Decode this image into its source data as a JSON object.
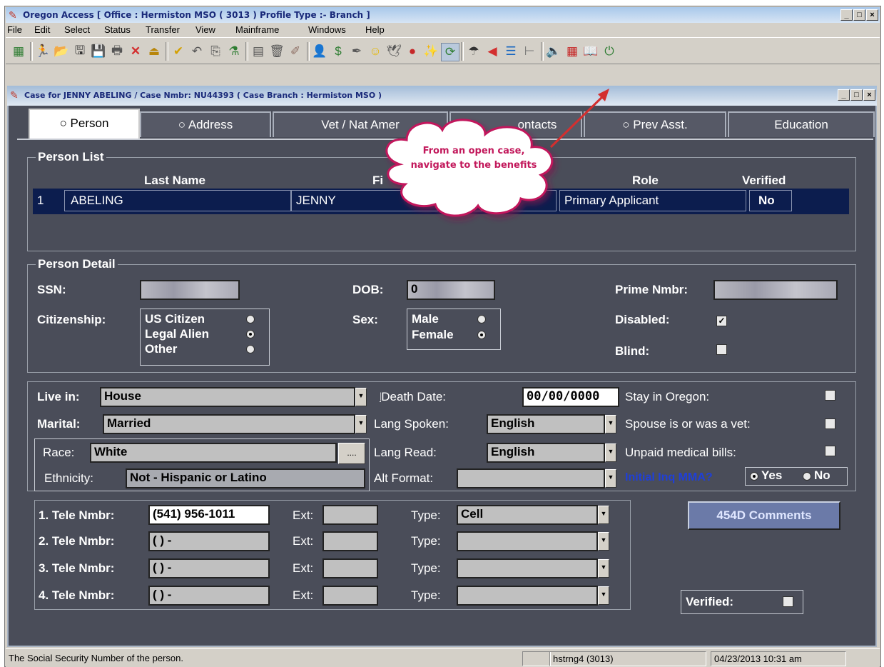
{
  "app": {
    "title": "Oregon Access [ Office : Hermiston MSO ( 3013 ) Profile Type :- Branch ]",
    "menu": [
      "File",
      "Edit",
      "Select",
      "Status",
      "Transfer",
      "View",
      "Mainframe",
      "Windows",
      "Help"
    ]
  },
  "toolbar": {
    "icons": [
      "grid-icon",
      "run-icon",
      "open-folder-icon",
      "save-all-icon",
      "save-icon",
      "print-icon",
      "delete-icon",
      "exit-icon",
      "check-icon",
      "undo-icon",
      "copy-icon",
      "flask-icon",
      "form-icon",
      "trash-icon",
      "pencil-tool-icon",
      "person-search-icon",
      "money-bag-icon",
      "pen-icon",
      "smiley-icon",
      "bird-icon",
      "apple-icon",
      "wand-icon",
      "refresh-icon",
      "umbrella-icon",
      "back-arrow-icon",
      "window-list-icon",
      "tree-icon",
      "speaker-icon",
      "calculator-icon",
      "book-icon",
      "power-icon"
    ]
  },
  "case_window": {
    "title": "Case for JENNY ABELING / Case Nmbr: NU44393 ( Case Branch : Hermiston MSO )",
    "tabs": [
      "○ Person",
      "○ Address",
      "Vet / Nat Amer",
      "ontacts",
      "○ Prev Asst.",
      "Education"
    ]
  },
  "callout": {
    "text": "From an open case, navigate to the benefits"
  },
  "person_list": {
    "label": "Person List",
    "headers": {
      "last_name": "Last Name",
      "first_name": "Fi",
      "role": "Role",
      "verified": "Verified"
    },
    "rows": [
      {
        "num": "1",
        "last": "ABELING",
        "first": "JENNY",
        "role": "Primary Applicant",
        "verified": "No"
      }
    ]
  },
  "person_detail": {
    "label": "Person Detail",
    "ssn_label": "SSN:",
    "dob_label": "DOB:",
    "dob_value": "0",
    "prime_label": "Prime Nmbr:",
    "citizenship_label": "Citizenship:",
    "citizenship_options": [
      "US Citizen",
      "Legal Alien",
      "Other"
    ],
    "citizenship_selected": "Legal Alien",
    "sex_label": "Sex:",
    "sex_options": [
      "Male",
      "Female"
    ],
    "sex_selected": "Female",
    "disabled_label": "Disabled:",
    "disabled_checked": true,
    "blind_label": "Blind:",
    "blind_checked": false
  },
  "details": {
    "live_in_label": "Live in:",
    "live_in_value": "House",
    "marital_label": "Marital:",
    "marital_value": "Married",
    "race_label": "Race:",
    "race_value": "White",
    "race_btn": "....",
    "ethnicity_label": "Ethnicity:",
    "ethnicity_value": "Not - Hispanic or Latino",
    "death_date_label": "Death Date:",
    "death_date_value": "00/00/0000",
    "lang_spoken_label": "Lang Spoken:",
    "lang_spoken_value": "English",
    "lang_read_label": "Lang Read:",
    "lang_read_value": "English",
    "alt_format_label": "Alt Format:",
    "stay_oregon_label": "Stay in Oregon:",
    "spouse_vet_label": "Spouse is or was a vet:",
    "unpaid_bills_label": "Unpaid medical bills:",
    "initial_inq_label": "Initial Inq MMA?",
    "initial_inq_yes": "Yes",
    "initial_inq_no": "No",
    "initial_inq_selected": "Yes"
  },
  "phones": {
    "rows": [
      {
        "label": "1. Tele Nmbr:",
        "number": "(541) 956-1011",
        "ext_label": "Ext:",
        "type_label": "Type:",
        "type": "Cell"
      },
      {
        "label": "2. Tele Nmbr:",
        "number": "(  )    -",
        "ext_label": "Ext:",
        "type_label": "Type:",
        "type": ""
      },
      {
        "label": "3. Tele Nmbr:",
        "number": "(  )    -",
        "ext_label": "Ext:",
        "type_label": "Type:",
        "type": ""
      },
      {
        "label": "4. Tele Nmbr:",
        "number": "(  )    -",
        "ext_label": "Ext:",
        "type_label": "Type:",
        "type": ""
      }
    ],
    "comments_btn": "454D Comments",
    "verified_label": "Verified:"
  },
  "status_bar": {
    "message": "The Social Security Number of the person.",
    "user": "hstrng4 (3013)",
    "datetime": "04/23/2013 10:31 am"
  },
  "colors": {
    "panel_bg": "#4a4d59",
    "selected_row": "#0c1d4e",
    "callout_fill": "#ffffff",
    "callout_text": "#c2185b",
    "arrow": "#d32f2f"
  }
}
